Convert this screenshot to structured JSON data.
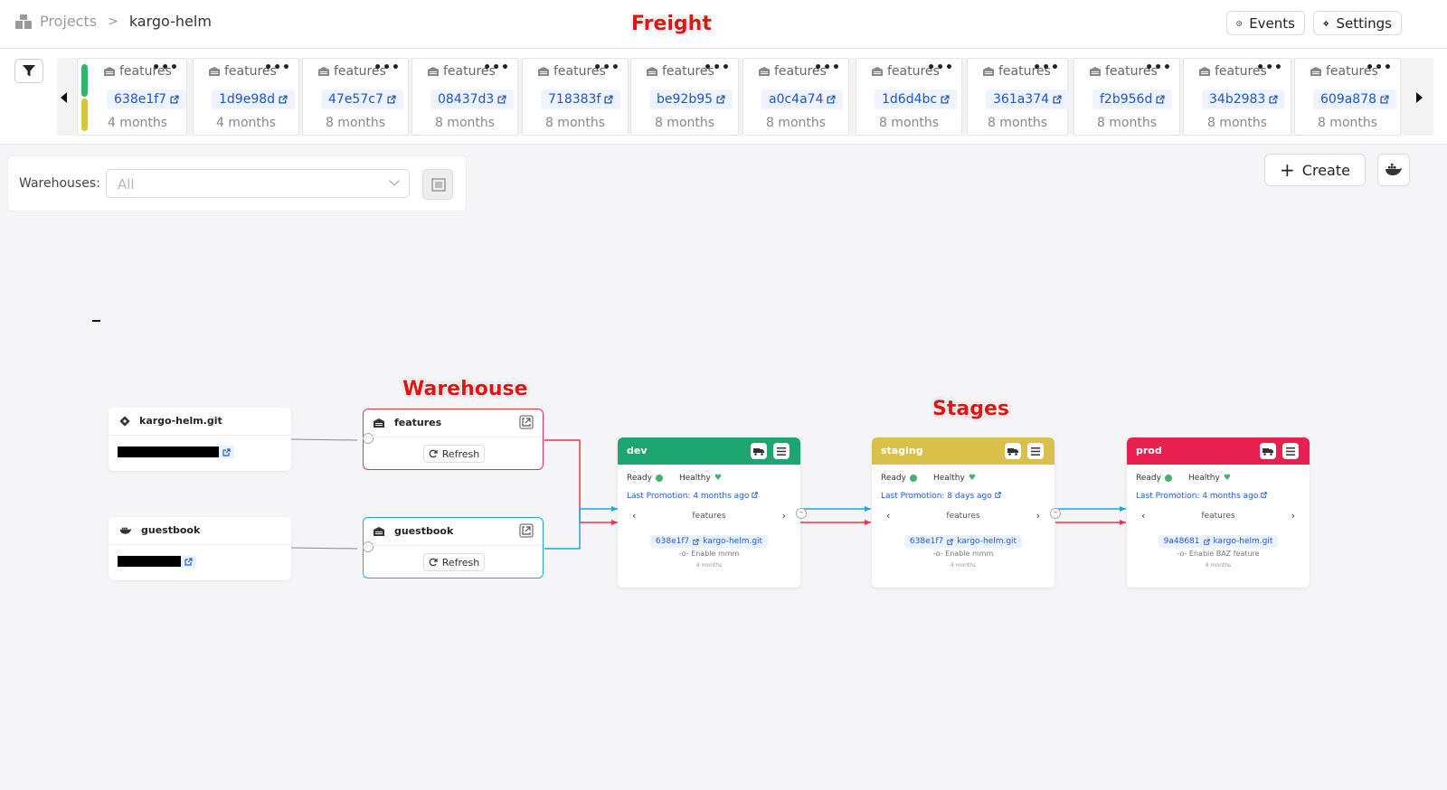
{
  "header": {
    "breadcrumb_root": "Projects",
    "breadcrumb_sep": ">",
    "project": "kargo-helm",
    "events_label": "Events",
    "settings_label": "Settings"
  },
  "annotations": {
    "freight": "Freight",
    "warehouse": "Warehouse",
    "stages": "Stages"
  },
  "freight": [
    {
      "warehouse": "features",
      "id": "638e1f7",
      "age": "4 months"
    },
    {
      "warehouse": "features",
      "id": "1d9e98d",
      "age": "4 months"
    },
    {
      "warehouse": "features",
      "id": "47e57c7",
      "age": "8 months"
    },
    {
      "warehouse": "features",
      "id": "08437d3",
      "age": "8 months"
    },
    {
      "warehouse": "features",
      "id": "718383f",
      "age": "8 months"
    },
    {
      "warehouse": "features",
      "id": "be92b95",
      "age": "8 months"
    },
    {
      "warehouse": "features",
      "id": "a0c4a74",
      "age": "8 months"
    },
    {
      "warehouse": "features",
      "id": "1d6d4bc",
      "age": "8 months"
    },
    {
      "warehouse": "features",
      "id": "361a374",
      "age": "8 months"
    },
    {
      "warehouse": "features",
      "id": "f2b956d",
      "age": "8 months"
    },
    {
      "warehouse": "features",
      "id": "34b2983",
      "age": "8 months"
    },
    {
      "warehouse": "features",
      "id": "609a878",
      "age": "8 months"
    }
  ],
  "toolbar": {
    "warehouses_label": "Warehouses:",
    "warehouses_value": "All",
    "create_label": "Create"
  },
  "repos": [
    {
      "name": "kargo-helm.git",
      "icon": "git-icon"
    },
    {
      "name": "guestbook",
      "icon": "docker-icon"
    }
  ],
  "warehouses": [
    {
      "name": "features",
      "refresh_label": "Refresh",
      "color": "#e8344e"
    },
    {
      "name": "guestbook",
      "refresh_label": "Refresh",
      "color": "#1fa8d8"
    }
  ],
  "stages": [
    {
      "name": "dev",
      "color": "#1ea672",
      "ready": "Ready",
      "healthy": "Healthy",
      "last_promotion_label": "Last Promotion:",
      "last_promotion": "4 months ago",
      "warehouse": "features",
      "freight_id": "638e1f7",
      "repo": "kargo-helm.git",
      "commit": "Enable mmm",
      "age": "4 months"
    },
    {
      "name": "staging",
      "color": "#d9c04a",
      "ready": "Ready",
      "healthy": "Healthy",
      "last_promotion_label": "Last Promotion:",
      "last_promotion": "8 days ago",
      "warehouse": "features",
      "freight_id": "638e1f7",
      "repo": "kargo-helm.git",
      "commit": "Enable mmm",
      "age": "4 months"
    },
    {
      "name": "prod",
      "color": "#e8204f",
      "ready": "Ready",
      "healthy": "Healthy",
      "last_promotion_label": "Last Promotion:",
      "last_promotion": "4 months ago",
      "warehouse": "features",
      "freight_id": "9a48681",
      "repo": "kargo-helm.git",
      "commit": "Enable BAZ feature",
      "age": "8 months"
    }
  ],
  "edge_colors": {
    "features": "#e8344e",
    "guestbook": "#1fa8d8",
    "repo_link": "#888888"
  }
}
